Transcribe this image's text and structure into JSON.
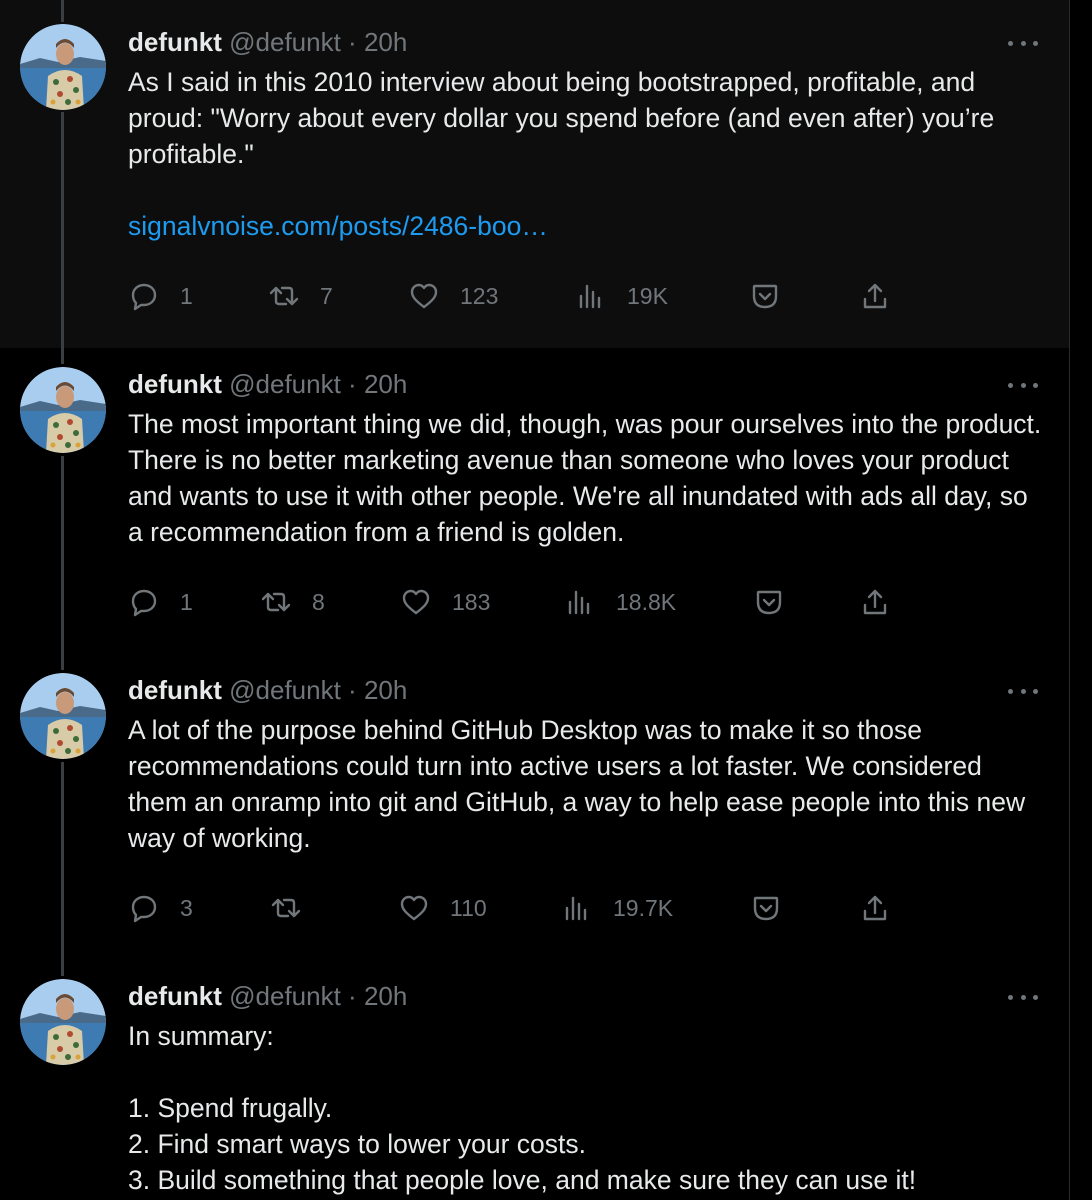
{
  "tweets": [
    {
      "name": "defunkt",
      "handle": "@defunkt",
      "dot": "·",
      "time": "20h",
      "text": "As I said in this 2010 interview about being bootstrapped, profitable, and proud: \"Worry about every dollar you spend before (and even after) you’re profitable.\"",
      "link": "signalvnoise.com/posts/2486-boo…",
      "replies": "1",
      "retweets": "7",
      "likes": "123",
      "views": "19K"
    },
    {
      "name": "defunkt",
      "handle": "@defunkt",
      "dot": "·",
      "time": "20h",
      "text": "The most important thing we did, though, was pour ourselves into the product. There is no better marketing avenue than someone who loves your product and wants to use it with other people. We're all inundated with ads all day, so a recommendation from a friend is golden.",
      "replies": "1",
      "retweets": "8",
      "likes": "183",
      "views": "18.8K"
    },
    {
      "name": "defunkt",
      "handle": "@defunkt",
      "dot": "·",
      "time": "20h",
      "text": "A lot of the purpose behind GitHub Desktop was to make it so those recommendations could turn into active users a lot faster. We considered them an onramp into git and GitHub, a way to help ease people into this new way of working.",
      "replies": "3",
      "retweets": "",
      "likes": "110",
      "views": "19.7K"
    },
    {
      "name": "defunkt",
      "handle": "@defunkt",
      "dot": "·",
      "time": "20h",
      "text": "In summary:\n\n1. Spend frugally.\n2. Find smart ways to lower your costs.\n3. Build something that people love, and make sure they can use it!"
    }
  ],
  "icons": {
    "reply": "reply-icon",
    "retweet": "retweet-icon",
    "like": "heart-icon",
    "views": "views-icon",
    "bookmark": "bookmark-icon",
    "share": "share-icon",
    "more": "more-icon"
  },
  "colors": {
    "background": "#000000",
    "highlight": "#0d0d0d",
    "text": "#e7e9ea",
    "muted": "#71767b",
    "link": "#1d9bf0",
    "thread_line": "#3b3e41"
  }
}
